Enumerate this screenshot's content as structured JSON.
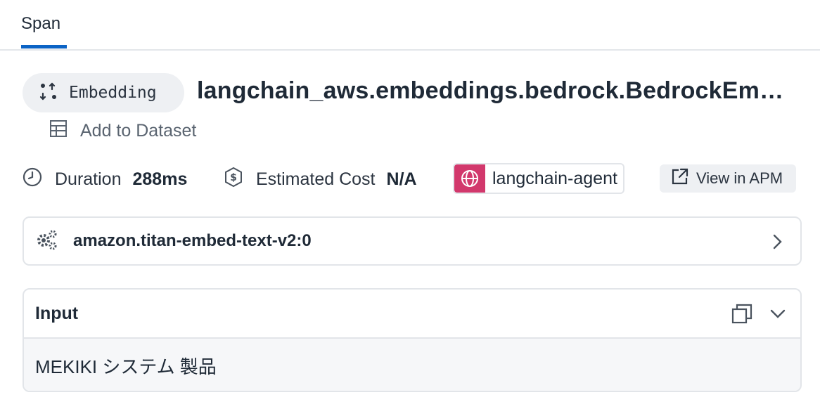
{
  "tabs": [
    {
      "label": "Span",
      "active": true
    }
  ],
  "span": {
    "kind": "Embedding",
    "kind_icon": "embedding-arrows-icon",
    "title": "langchain_aws.embeddings.bedrock.BedrockEm…"
  },
  "dataset": {
    "label": "Add to Dataset",
    "icon": "table-icon"
  },
  "metrics": {
    "duration_label": "Duration",
    "duration_value": "288ms",
    "cost_label": "Estimated Cost",
    "cost_value": "N/A"
  },
  "service": {
    "name": "langchain-agent",
    "icon": "globe-icon",
    "color": "#d2386c"
  },
  "apm_button": {
    "label": "View in APM",
    "icon": "external-link-icon"
  },
  "model": {
    "name": "amazon.titan-embed-text-v2:0",
    "icon": "gears-icon"
  },
  "input": {
    "title": "Input",
    "content": "MEKIKI システム 製品"
  },
  "colors": {
    "accent": "#0b63c5",
    "service": "#d2386c"
  }
}
